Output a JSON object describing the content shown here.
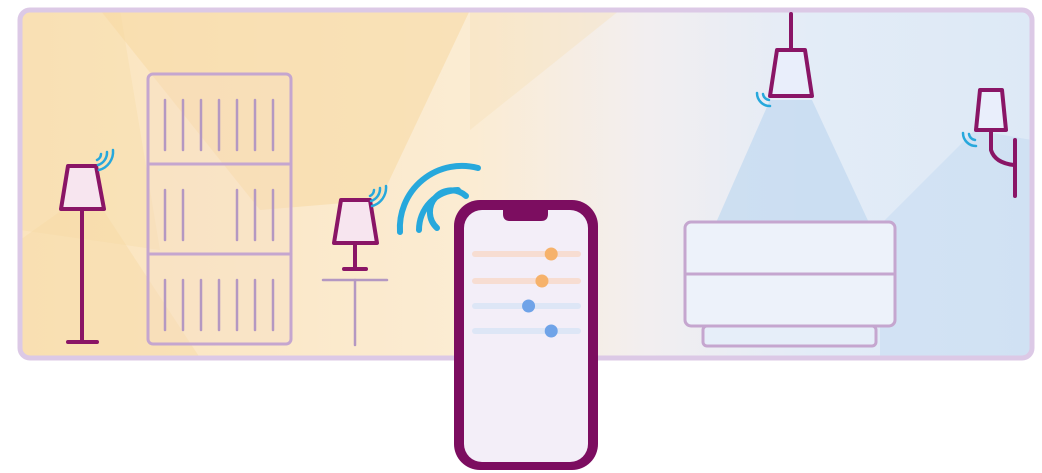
{
  "colors": {
    "frame": "#dcc9e6",
    "warm": "#fbe6c4",
    "warm_beam": "#f7d9a3",
    "cool": "#dbe8f6",
    "cool_beam": "#c3d9f0",
    "lamp_stroke": "#8a1566",
    "signal": "#27a8dc",
    "furniture": "#c5a6cf",
    "phone_body": "#7c0d60",
    "phone_screen": "#f3eef8",
    "slider_warm": "#f6b26b",
    "slider_cool": "#6fa3e8"
  },
  "icons": {
    "floor_lamp": "floor-lamp-icon",
    "bookshelf": "bookshelf-icon",
    "table_lamp": "table-lamp-icon",
    "pendant_lamp": "pendant-lamp-icon",
    "wall_lamp": "wall-lamp-icon",
    "sofa": "sofa-icon",
    "smartphone": "smartphone-icon",
    "wifi": "wifi-signal-icon"
  },
  "phone": {
    "sliders": [
      {
        "tone": "warm",
        "level": 0.74
      },
      {
        "tone": "warm",
        "level": 0.65
      },
      {
        "tone": "cool",
        "level": 0.52
      },
      {
        "tone": "cool",
        "level": 0.74
      }
    ]
  }
}
